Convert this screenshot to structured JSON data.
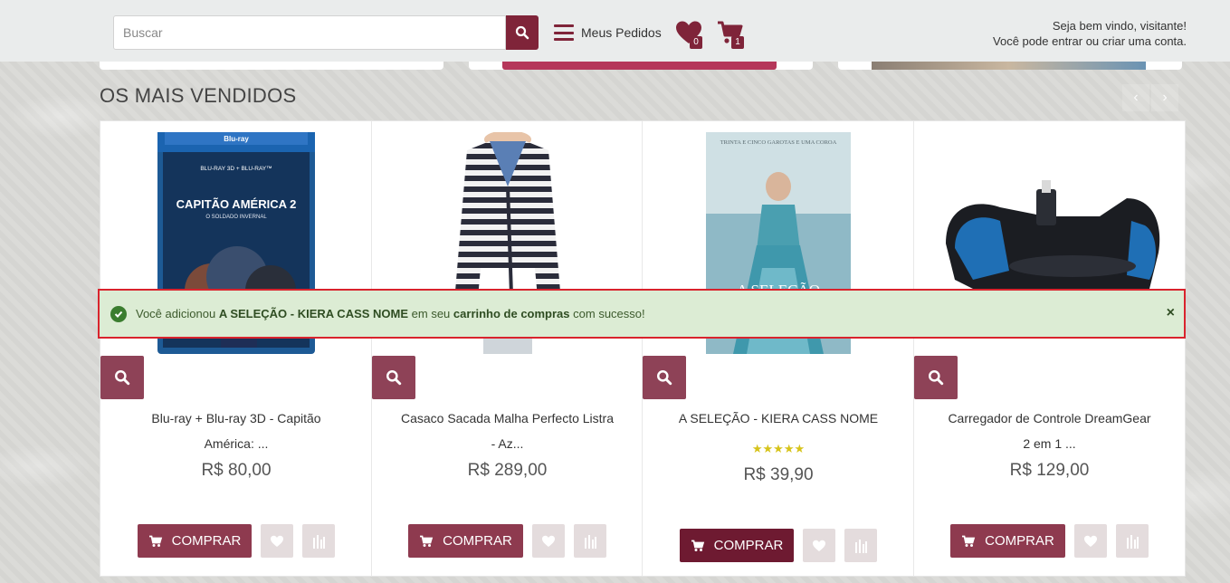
{
  "header": {
    "search_placeholder": "Buscar",
    "orders_label": "Meus Pedidos",
    "wishlist_count": "0",
    "cart_count": "1",
    "welcome_line": "Seja bem vindo, visitante!",
    "login_prefix": "Você pode",
    "login_link": "entrar",
    "login_or": "ou",
    "register_link": "criar uma conta."
  },
  "section": {
    "title": "OS MAIS VENDIDOS",
    "prev": "‹",
    "next": "›"
  },
  "alert": {
    "prefix": "Você adicionou",
    "product": "A SELEÇÃO - KIERA CASS NOME",
    "middle": "em seu",
    "cart_link": "carrinho de compras",
    "suffix": "com sucesso!",
    "close": "×"
  },
  "products": [
    {
      "name_line1": "Blu-ray + Blu-ray 3D - Capitão",
      "name_line2": "América: ...",
      "price": "R$ 80,00",
      "buy_label": "COMPRAR",
      "cover_top": "BLU-RAY 3D + BLU-RAY™",
      "cover_title": "CAPITÃO AMÉRICA 2",
      "cover_sub": "O SOLDADO INVERNAL"
    },
    {
      "name_line1": "Casaco Sacada Malha Perfecto Listra",
      "name_line2": "- Az...",
      "price": "R$ 289,00",
      "buy_label": "COMPRAR"
    },
    {
      "name_line1": "A SELEÇÃO - KIERA CASS NOME",
      "name_line2": "",
      "rating": "★★★★★",
      "price": "R$ 39,90",
      "buy_label": "COMPRAR",
      "cover_top": "TRINTA E CINCO GAROTAS E UMA COROA",
      "cover_title": "A SELEÇÃO"
    },
    {
      "name_line1": "Carregador de Controle DreamGear",
      "name_line2": "2 em 1 ...",
      "price": "R$ 129,00",
      "buy_label": "COMPRAR"
    }
  ],
  "colors": {
    "brand": "#7f2439",
    "zoom_button": "#8e4257",
    "alert_bg": "#dcecd4",
    "alert_border": "#d9232d",
    "rating": "#d6c31a"
  }
}
